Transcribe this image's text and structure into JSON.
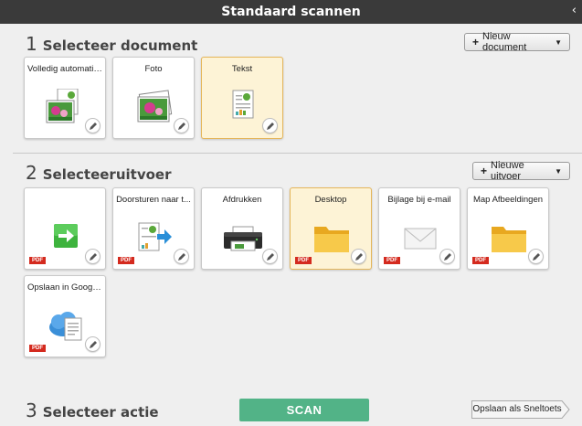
{
  "window": {
    "title": "Standaard scannen",
    "collapse_icon": "chevron-left-icon"
  },
  "section1": {
    "number": "1",
    "title": "Selecteer document",
    "new_button": {
      "label": "Nieuw document",
      "plus": "+",
      "caret": "▼"
    },
    "cards": [
      {
        "label": "Volledig automatis...",
        "icon": "auto-document-icon",
        "selected": false
      },
      {
        "label": "Foto",
        "icon": "photo-icon",
        "selected": false
      },
      {
        "label": "Tekst",
        "icon": "text-document-icon",
        "selected": true
      }
    ]
  },
  "section2": {
    "number": "2",
    "title": "Selecteeruitvoer",
    "new_button": {
      "label": "Nieuwe uitvoer",
      "plus": "+",
      "caret": "▼"
    },
    "cards": [
      {
        "label": "",
        "icon": "green-arrow-icon",
        "badge": "PDF",
        "selected": false
      },
      {
        "label": "Doorsturen naar t...",
        "icon": "forward-to-app-icon",
        "badge": "PDF",
        "selected": false
      },
      {
        "label": "Afdrukken",
        "icon": "printer-icon",
        "badge": "",
        "selected": false
      },
      {
        "label": "Desktop",
        "icon": "folder-icon",
        "badge": "PDF",
        "selected": true
      },
      {
        "label": "Bijlage bij e-mail",
        "icon": "envelope-icon",
        "badge": "PDF",
        "selected": false
      },
      {
        "label": "Map Afbeeldingen",
        "icon": "folder-icon",
        "badge": "PDF",
        "selected": false
      },
      {
        "label": "Opslaan in Google...",
        "icon": "cloud-document-icon",
        "badge": "PDF",
        "selected": false
      }
    ]
  },
  "section3": {
    "number": "3",
    "title": "Selecteer actie",
    "scan_label": "SCAN",
    "shortcut_label": "Opslaan als Sneltoets"
  },
  "colors": {
    "titlebar": "#3a3a3a",
    "scan": "#52b387",
    "selected": "#fdf3d6",
    "pdf": "#d42a1e"
  }
}
